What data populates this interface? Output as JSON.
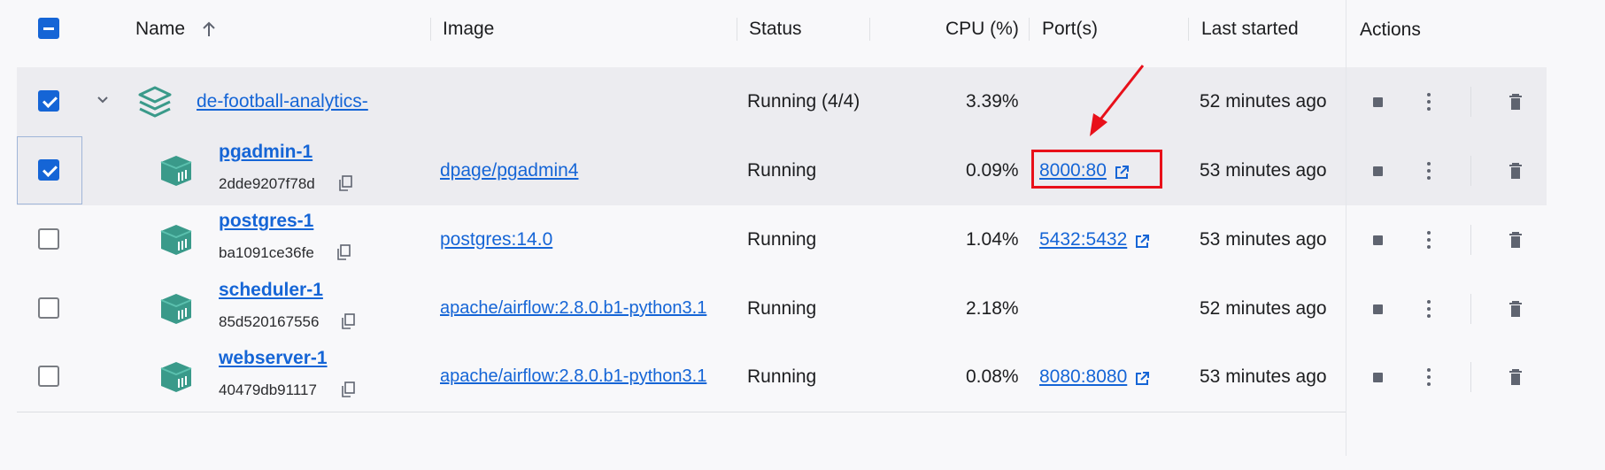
{
  "header": {
    "name_label": "Name",
    "image_label": "Image",
    "status_label": "Status",
    "cpu_label": "CPU (%)",
    "ports_label": "Port(s)",
    "last_started_label": "Last started",
    "actions_label": "Actions"
  },
  "group": {
    "name": "de-football-analytics-",
    "status": "Running (4/4)",
    "cpu": "3.39%",
    "last_started": "52 minutes ago",
    "checked": true
  },
  "containers": [
    {
      "name": "pgadmin-1",
      "id": "2dde9207f78d",
      "image": "dpage/pgadmin4",
      "status": "Running",
      "cpu": "0.09%",
      "port": "8000:80",
      "last_started": "53 minutes ago",
      "checked": true
    },
    {
      "name": "postgres-1",
      "id": "ba1091ce36fe",
      "image": "postgres:14.0",
      "status": "Running",
      "cpu": "1.04%",
      "port": "5432:5432",
      "last_started": "53 minutes ago",
      "checked": false
    },
    {
      "name": "scheduler-1",
      "id": "85d520167556",
      "image": "apache/airflow:2.8.0.b1-python3.1",
      "status": "Running",
      "cpu": "2.18%",
      "port": "",
      "last_started": "52 minutes ago",
      "checked": false
    },
    {
      "name": "webserver-1",
      "id": "40479db91117",
      "image": "apache/airflow:2.8.0.b1-python3.1",
      "status": "Running",
      "cpu": "0.08%",
      "port": "8080:8080",
      "last_started": "53 minutes ago",
      "checked": false
    }
  ],
  "colors": {
    "accent": "#1565d6",
    "container_icon": "#3a9a8a",
    "annotation": "#e8101a",
    "selected_row": "#ececf0"
  },
  "icons": {
    "sort": "arrow-up-icon",
    "expand": "chevron-down-icon",
    "stack": "stack-icon",
    "container": "container-icon",
    "copy": "copy-icon",
    "external": "external-link-icon",
    "stop": "stop-icon",
    "more": "more-vertical-icon",
    "delete": "trash-icon"
  }
}
